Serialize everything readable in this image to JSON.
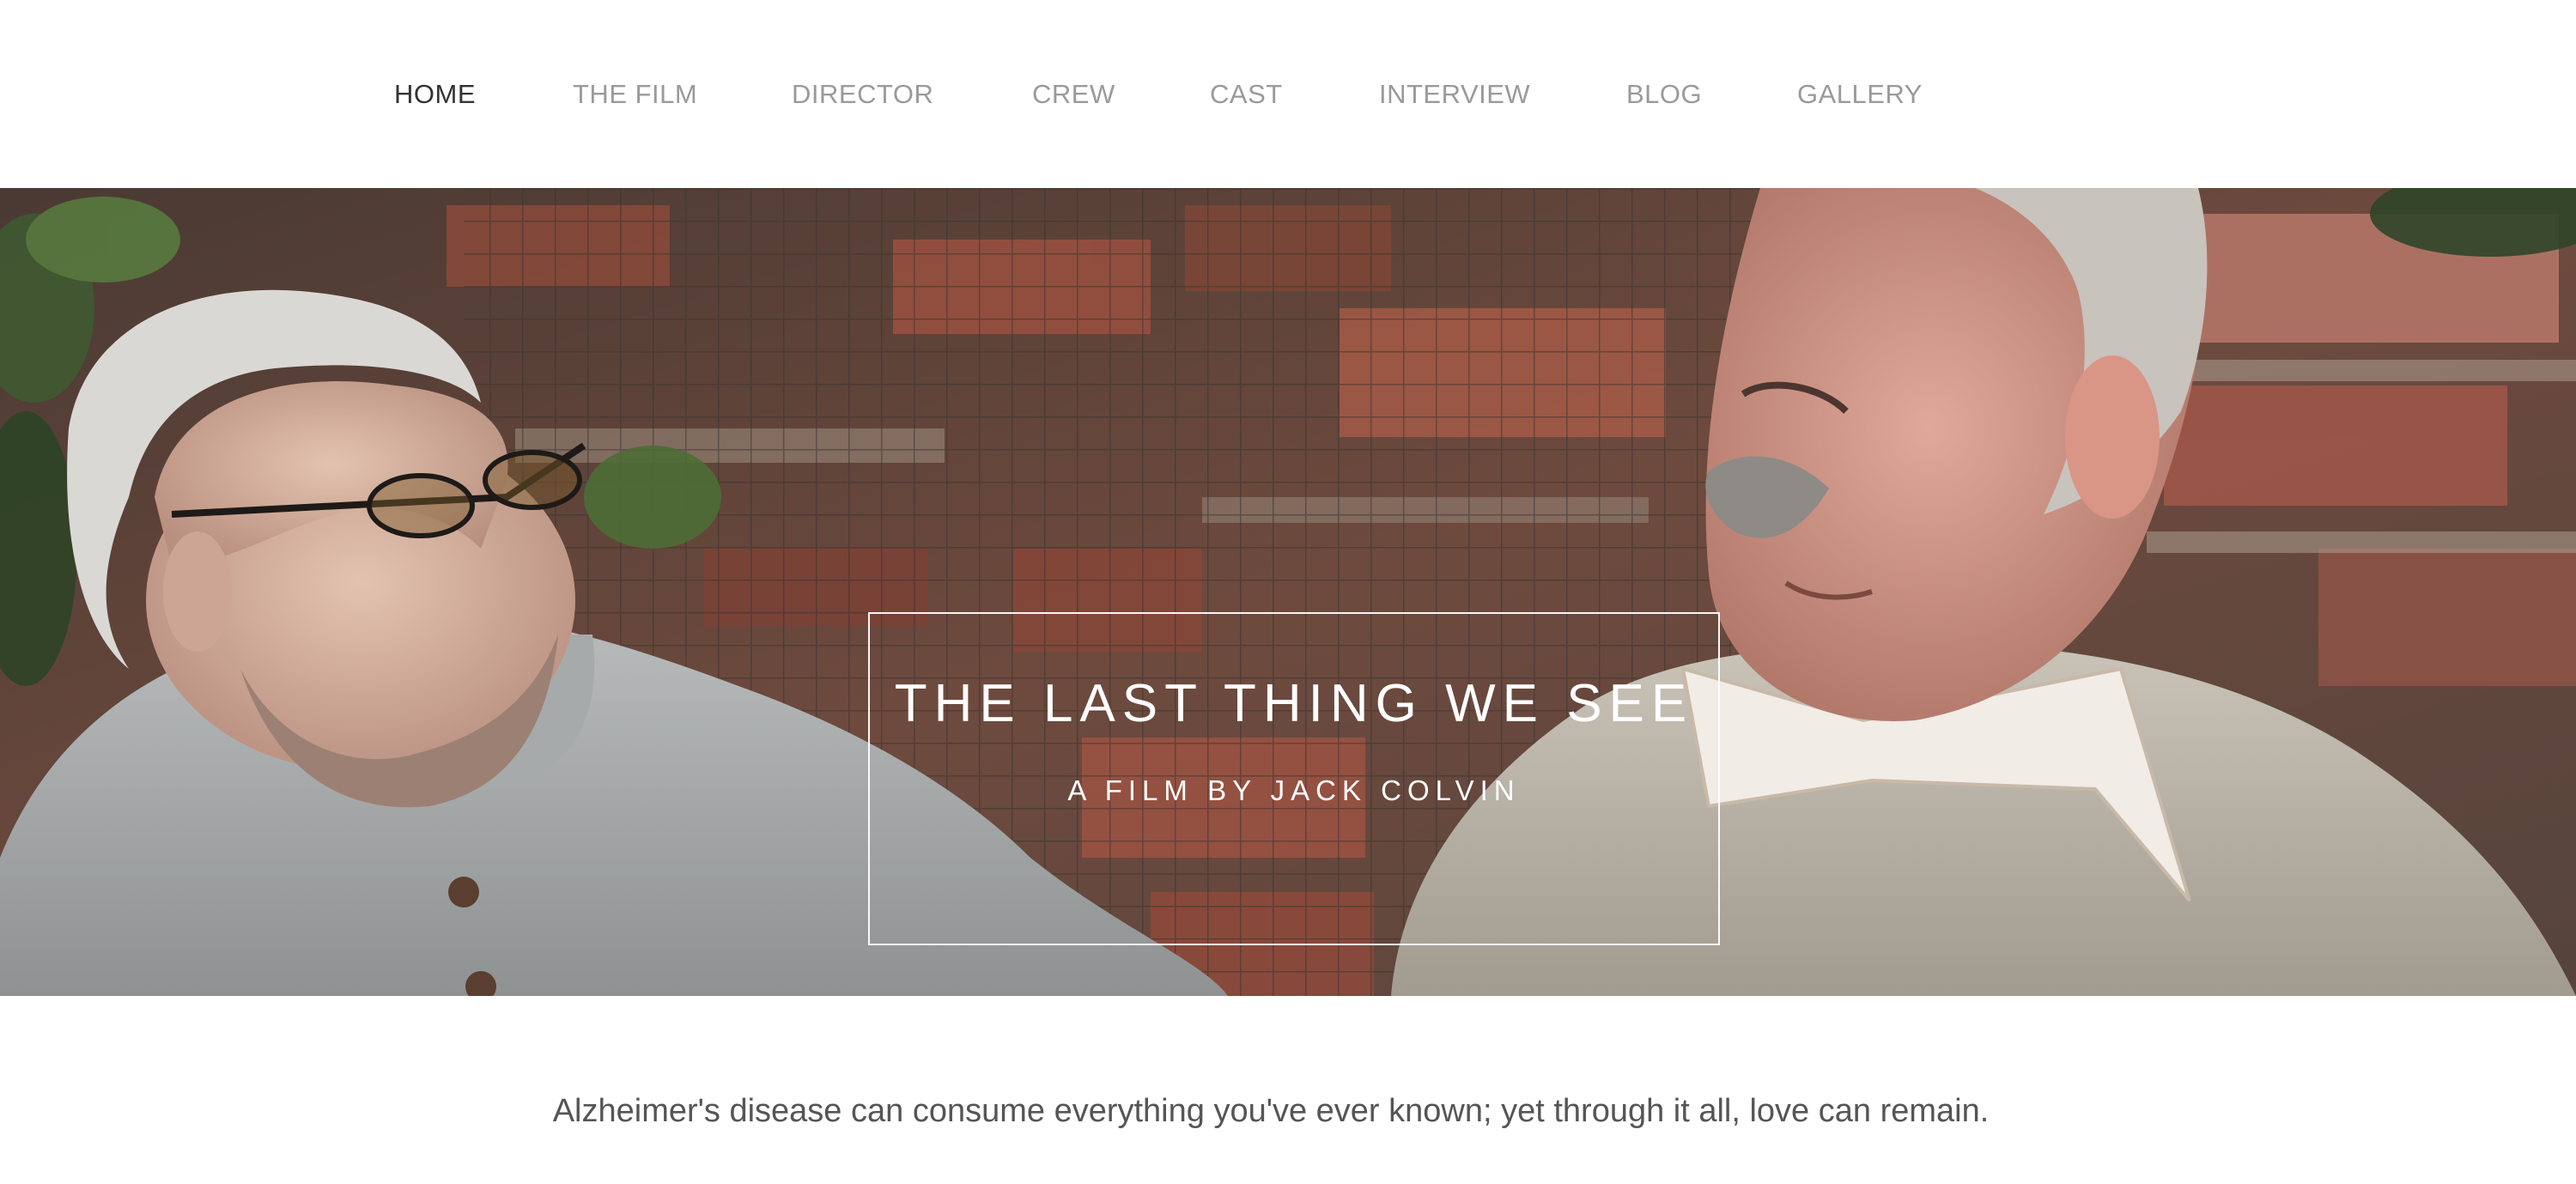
{
  "nav": {
    "items": [
      {
        "label": "HOME",
        "active": true
      },
      {
        "label": "THE FILM",
        "active": false
      },
      {
        "label": "DIRECTOR",
        "active": false
      },
      {
        "label": "CREW",
        "active": false
      },
      {
        "label": "CAST",
        "active": false
      },
      {
        "label": "INTERVIEW",
        "active": false
      },
      {
        "label": "BLOG",
        "active": false
      },
      {
        "label": "GALLERY",
        "active": false
      }
    ]
  },
  "hero": {
    "title": "THE LAST THING WE SEE",
    "subtitle": "A FILM BY JACK COLVIN"
  },
  "tagline": "Alzheimer's disease can consume everything you've ever known; yet through it all, love can remain.",
  "colors": {
    "nav_active": "#333333",
    "nav_inactive": "#9a9a9a",
    "title_text": "#ffffff",
    "tagline_text": "#555555"
  }
}
